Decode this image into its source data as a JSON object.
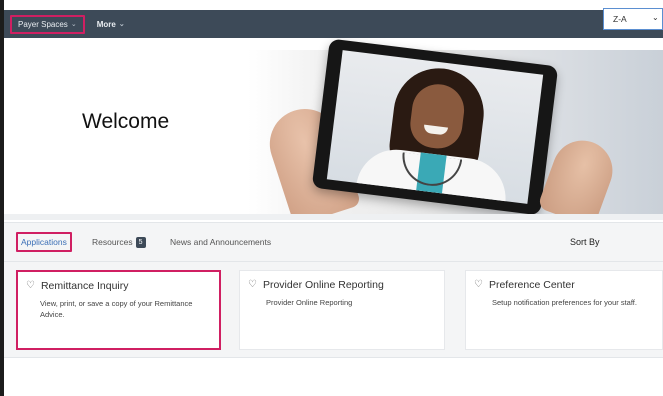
{
  "topnav": {
    "items": [
      {
        "label": "Payer Spaces"
      },
      {
        "label": "More"
      }
    ]
  },
  "hero": {
    "title": "Welcome"
  },
  "tabs": {
    "items": [
      {
        "label": "Applications"
      },
      {
        "label": "Resources",
        "badge": "5"
      },
      {
        "label": "News and Announcements"
      }
    ]
  },
  "sort": {
    "label": "Sort By",
    "value": "Z-A"
  },
  "cards": [
    {
      "title": "Remittance Inquiry",
      "description": "View, print, or save a copy of your Remittance Advice."
    },
    {
      "title": "Provider Online Reporting",
      "description": "Provider Online Reporting"
    },
    {
      "title": "Preference Center",
      "description": "Setup notification preferences for your staff."
    }
  ],
  "icons": {
    "nav_dropdown": "chevron-down-icon",
    "card_favorite": "heart-outline-icon",
    "sort_dropdown": "chevron-down-icon"
  },
  "colors": {
    "nav_bg": "#3d4a58",
    "highlight": "#d01f62",
    "link": "#3b6fb6",
    "select_border": "#5b8fd1"
  }
}
